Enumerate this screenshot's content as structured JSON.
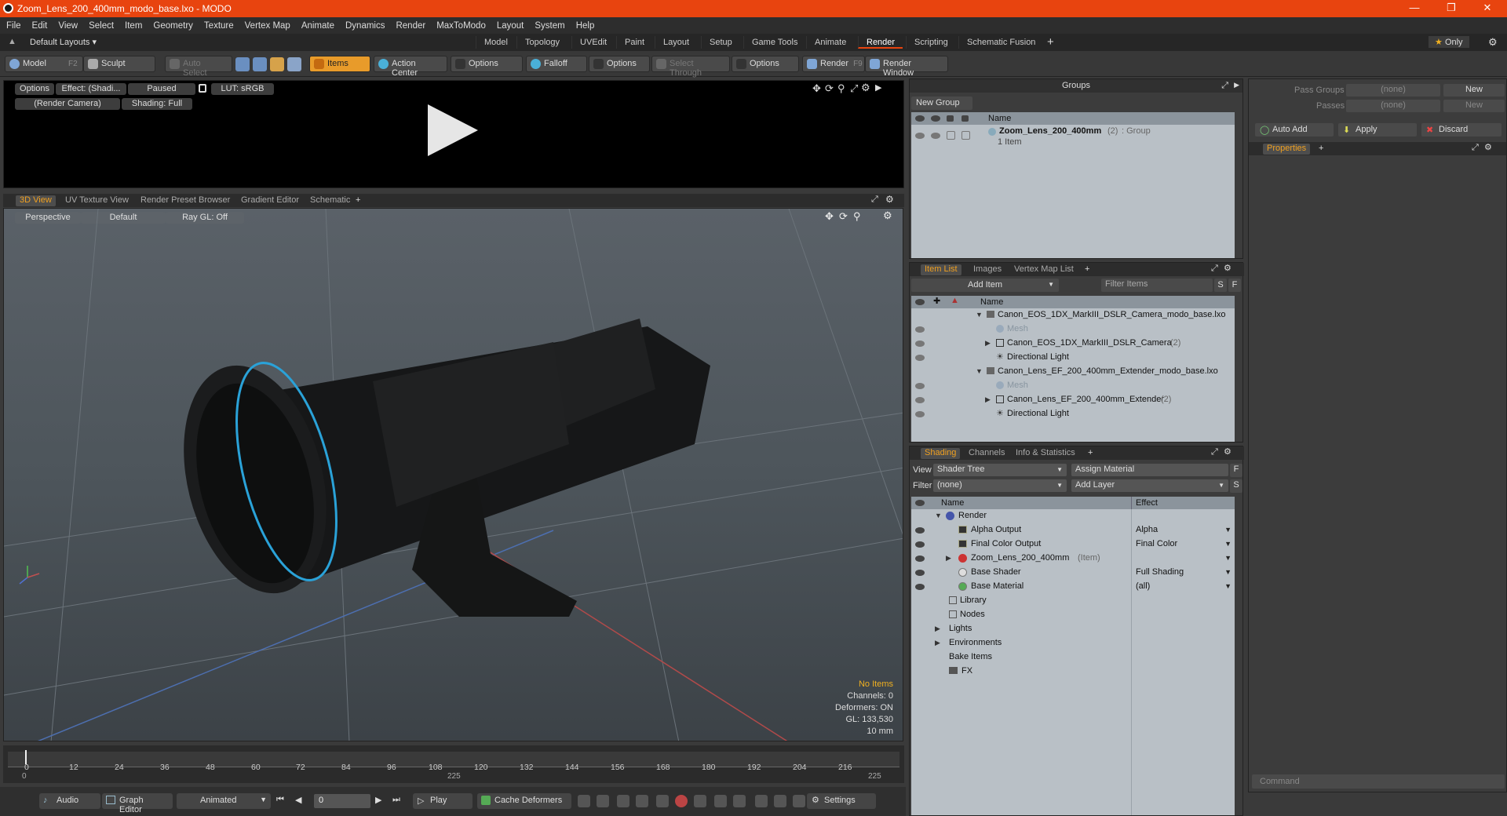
{
  "window": {
    "title": "Zoom_Lens_200_400mm_modo_base.lxo - MODO"
  },
  "menu": [
    "File",
    "Edit",
    "View",
    "Select",
    "Item",
    "Geometry",
    "Texture",
    "Vertex Map",
    "Animate",
    "Dynamics",
    "Render",
    "MaxToModo",
    "Layout",
    "System",
    "Help"
  ],
  "layouts": {
    "default": "Default Layouts",
    "tabs": [
      "Model",
      "Topology",
      "UVEdit",
      "Paint",
      "Layout",
      "Setup",
      "Game Tools",
      "Animate",
      "Render",
      "Scripting",
      "Schematic Fusion"
    ],
    "active": "Render",
    "only": "Only"
  },
  "toolbar": {
    "model": "Model",
    "model_key": "F2",
    "sculpt": "Sculpt",
    "auto_select": "Auto Select",
    "items": "Items",
    "action_center": "Action Center",
    "options1": "Options",
    "falloff": "Falloff",
    "options2": "Options",
    "select_through": "Select Through",
    "options3": "Options",
    "render": "Render",
    "render_key": "F9",
    "render_window": "Render Window"
  },
  "render_preview": {
    "options": "Options",
    "effect": "Effect: (Shadi...",
    "paused": "Paused",
    "lut": "LUT: sRGB",
    "camera": "(Render Camera)",
    "shading": "Shading: Full"
  },
  "view_tabs": [
    "3D View",
    "UV Texture View",
    "Render Preset Browser",
    "Gradient Editor",
    "Schematic"
  ],
  "viewport": {
    "perspective": "Perspective",
    "default": "Default",
    "raygl": "Ray GL: Off",
    "info": {
      "items": "No Items",
      "channels": "Channels: 0",
      "deformers": "Deformers: ON",
      "gl": "GL: 133,530",
      "size": "10 mm"
    }
  },
  "timeline": {
    "ticks": [
      "0",
      "12",
      "24",
      "36",
      "48",
      "60",
      "72",
      "84",
      "96",
      "108",
      "120",
      "132",
      "144",
      "156",
      "168",
      "180",
      "192",
      "204",
      "216"
    ],
    "start": "0",
    "mid": "225",
    "end": "225"
  },
  "bottom": {
    "audio": "Audio",
    "graph_editor": "Graph Editor",
    "animated": "Animated",
    "frame": "0",
    "play": "Play",
    "cache": "Cache Deformers",
    "settings": "Settings"
  },
  "groups": {
    "title": "Groups",
    "new_group": "New Group",
    "name_col": "Name",
    "item": "Zoom_Lens_200_400mm",
    "item_count": "(2)",
    "item_type": ": Group",
    "item_sub": "1 Item"
  },
  "passes": {
    "pass_groups": "Pass Groups",
    "passes": "Passes",
    "none1": "(none)",
    "none2": "(none)",
    "new1": "New",
    "new2": "New",
    "auto_add": "Auto Add",
    "apply": "Apply",
    "discard": "Discard",
    "properties": "Properties"
  },
  "item_list": {
    "tabs": [
      "Item List",
      "Images",
      "Vertex Map List"
    ],
    "add_item": "Add Item",
    "filter": "Filter Items",
    "s": "S",
    "f": "F",
    "name_col": "Name",
    "rows": [
      {
        "label": "Canon_EOS_1DX_MarkIII_DSLR_Camera_modo_base.lxo",
        "count": ""
      },
      {
        "label": "Mesh",
        "count": ""
      },
      {
        "label": "Canon_EOS_1DX_MarkIII_DSLR_Camera",
        "count": "(2)"
      },
      {
        "label": "Directional Light",
        "count": ""
      },
      {
        "label": "Canon_Lens_EF_200_400mm_Extender_modo_base.lxo",
        "count": ""
      },
      {
        "label": "Mesh",
        "count": ""
      },
      {
        "label": "Canon_Lens_EF_200_400mm_Extender",
        "count": "(2)"
      },
      {
        "label": "Directional Light",
        "count": ""
      }
    ]
  },
  "shading": {
    "tabs": [
      "Shading",
      "Channels",
      "Info & Statistics"
    ],
    "view_label": "View",
    "view_value": "Shader Tree",
    "assign": "Assign Material",
    "f": "F",
    "filter_label": "Filter",
    "filter_value": "(none)",
    "add_layer": "Add Layer",
    "s": "S",
    "name_col": "Name",
    "effect_col": "Effect",
    "rows": [
      {
        "name": "Render",
        "effect": ""
      },
      {
        "name": "Alpha Output",
        "effect": "Alpha"
      },
      {
        "name": "Final Color Output",
        "effect": "Final Color"
      },
      {
        "name": "Zoom_Lens_200_400mm",
        "suffix": "(Item)",
        "effect": ""
      },
      {
        "name": "Base Shader",
        "effect": "Full Shading"
      },
      {
        "name": "Base Material",
        "effect": "(all)"
      },
      {
        "name": "Library",
        "effect": ""
      },
      {
        "name": "Nodes",
        "effect": ""
      },
      {
        "name": "Lights",
        "effect": ""
      },
      {
        "name": "Environments",
        "effect": ""
      },
      {
        "name": "Bake Items",
        "effect": ""
      },
      {
        "name": "FX",
        "effect": ""
      }
    ]
  },
  "command": {
    "placeholder": "Command"
  }
}
